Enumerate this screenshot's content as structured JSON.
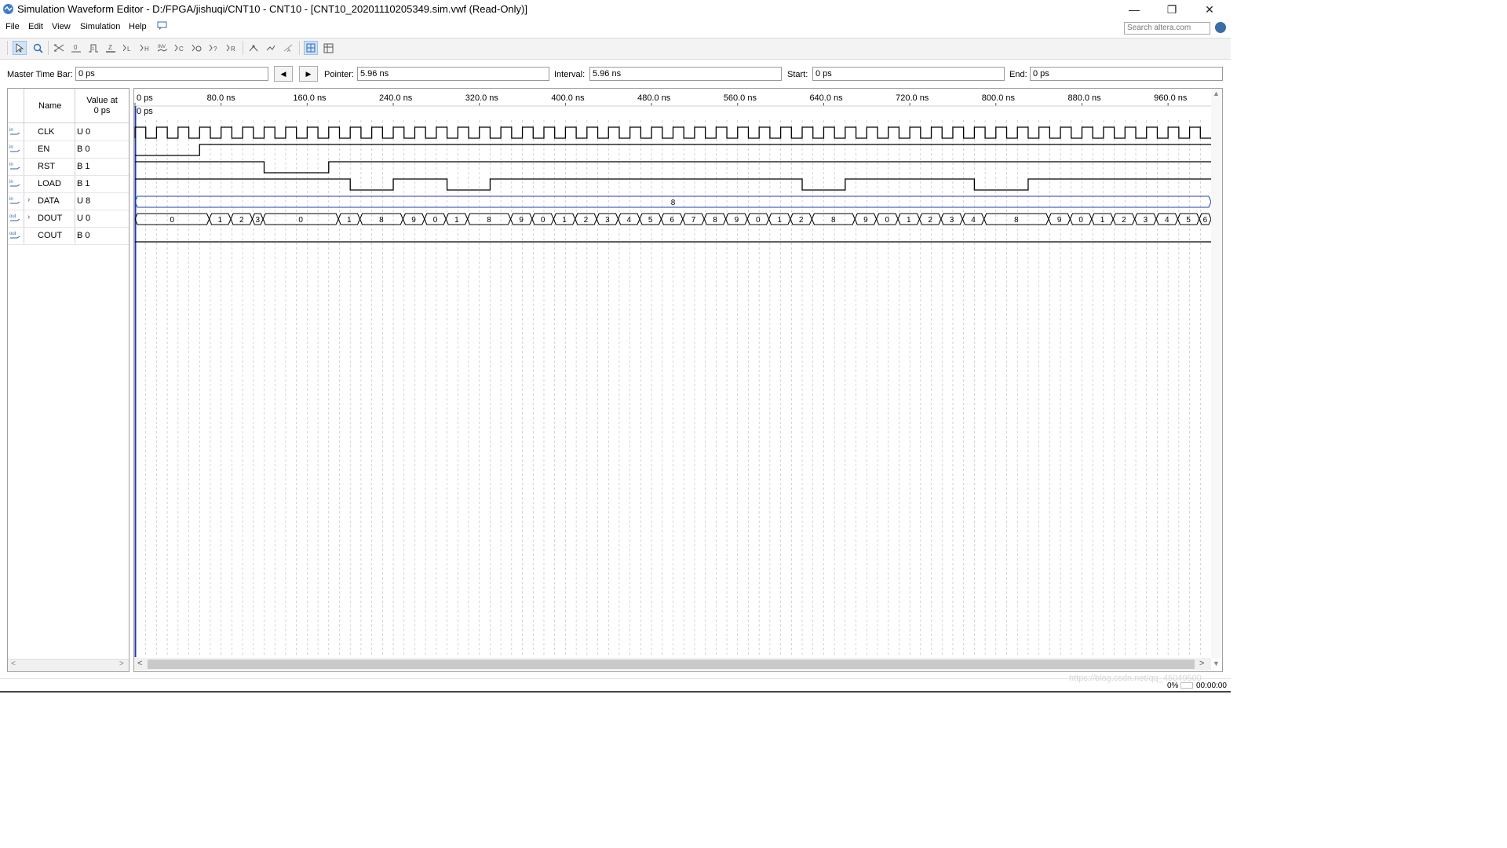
{
  "window": {
    "title": "Simulation Waveform Editor - D:/FPGA/jishuqi/CNT10 - CNT10 - [CNT10_20201110205349.sim.vwf (Read-Only)]",
    "min_glyph": "—",
    "max_glyph": "❐",
    "close_glyph": "✕"
  },
  "menu": {
    "items": [
      "File",
      "Edit",
      "View",
      "Simulation",
      "Help"
    ],
    "search_placeholder": "Search altera.com"
  },
  "toolbar": {
    "icons": [
      "select-tool",
      "zoom-tool",
      "forcing-unknown",
      "forcing-low",
      "forcing-high",
      "high-impedance",
      "weak-low",
      "weak-high",
      "invert",
      "count-value",
      "clock",
      "random-value",
      "overwrite-value",
      "snap-to-grid",
      "arbitrary-value",
      "grid-toggle",
      "display-settings"
    ]
  },
  "timebar": {
    "master_label": "Master Time Bar:",
    "master_value": "0 ps",
    "prev_glyph": "◀",
    "next_glyph": "▶",
    "pointer_label": "Pointer:",
    "pointer_value": "5.96 ns",
    "interval_label": "Interval:",
    "interval_value": "5.96 ns",
    "start_label": "Start:",
    "start_value": "0 ps",
    "end_label": "End:",
    "end_value": "0 ps"
  },
  "signals": {
    "header_name": "Name",
    "header_value_line1": "Value at",
    "header_value_line2": "0 ps",
    "rows": [
      {
        "dir": "in",
        "expand": "",
        "name": "CLK",
        "value": "U 0"
      },
      {
        "dir": "in",
        "expand": "",
        "name": "EN",
        "value": "B 0"
      },
      {
        "dir": "in",
        "expand": "",
        "name": "RST",
        "value": "B 1"
      },
      {
        "dir": "in",
        "expand": "",
        "name": "LOAD",
        "value": "B 1"
      },
      {
        "dir": "in",
        "expand": "›",
        "name": "DATA",
        "value": "U 8"
      },
      {
        "dir": "out",
        "expand": "›",
        "name": "DOUT",
        "value": "U 0"
      },
      {
        "dir": "out",
        "expand": "",
        "name": "COUT",
        "value": "B 0"
      }
    ]
  },
  "timeline": {
    "unit": "ns",
    "ticks": [
      {
        "t": 0,
        "label": "0 ps"
      },
      {
        "t": 80,
        "label": "80.0 ns"
      },
      {
        "t": 160,
        "label": "160.0 ns"
      },
      {
        "t": 240,
        "label": "240.0 ns"
      },
      {
        "t": 320,
        "label": "320.0 ns"
      },
      {
        "t": 400,
        "label": "400.0 ns"
      },
      {
        "t": 480,
        "label": "480.0 ns"
      },
      {
        "t": 560,
        "label": "560.0 ns"
      },
      {
        "t": 640,
        "label": "640.0 ns"
      },
      {
        "t": 720,
        "label": "720.0 ns"
      },
      {
        "t": 800,
        "label": "800.0 ns"
      },
      {
        "t": 880,
        "label": "880.0 ns"
      },
      {
        "t": 960,
        "label": "960.0 ns"
      }
    ],
    "master_marker_label": "0 ps",
    "view_end": 1000,
    "clock_period": 20
  },
  "waveforms": {
    "EN": [
      [
        0,
        0
      ],
      [
        60,
        1
      ]
    ],
    "RST": [
      [
        0,
        1
      ],
      [
        120,
        0
      ],
      [
        180,
        1
      ]
    ],
    "LOAD": [
      [
        0,
        1
      ],
      [
        200,
        0
      ],
      [
        240,
        1
      ],
      [
        290,
        0
      ],
      [
        330,
        1
      ],
      [
        620,
        0
      ],
      [
        660,
        1
      ],
      [
        780,
        0
      ],
      [
        830,
        1
      ]
    ],
    "COUT": [
      [
        0,
        0
      ]
    ],
    "DATA_bus": [
      {
        "start": 0,
        "end": 1000,
        "label": "8"
      }
    ],
    "DOUT_bus": [
      {
        "start": 0,
        "end": 69,
        "label": "0"
      },
      {
        "start": 69,
        "end": 89,
        "label": "1"
      },
      {
        "start": 89,
        "end": 109,
        "label": "2"
      },
      {
        "start": 109,
        "end": 119,
        "label": "3"
      },
      {
        "start": 119,
        "end": 189,
        "label": "0"
      },
      {
        "start": 189,
        "end": 209,
        "label": "1"
      },
      {
        "start": 209,
        "end": 249,
        "label": "8"
      },
      {
        "start": 249,
        "end": 269,
        "label": "9"
      },
      {
        "start": 269,
        "end": 289,
        "label": "0"
      },
      {
        "start": 289,
        "end": 309,
        "label": "1"
      },
      {
        "start": 309,
        "end": 349,
        "label": "8"
      },
      {
        "start": 349,
        "end": 369,
        "label": "9"
      },
      {
        "start": 369,
        "end": 389,
        "label": "0"
      },
      {
        "start": 389,
        "end": 409,
        "label": "1"
      },
      {
        "start": 409,
        "end": 429,
        "label": "2"
      },
      {
        "start": 429,
        "end": 449,
        "label": "3"
      },
      {
        "start": 449,
        "end": 469,
        "label": "4"
      },
      {
        "start": 469,
        "end": 489,
        "label": "5"
      },
      {
        "start": 489,
        "end": 509,
        "label": "6"
      },
      {
        "start": 509,
        "end": 529,
        "label": "7"
      },
      {
        "start": 529,
        "end": 549,
        "label": "8"
      },
      {
        "start": 549,
        "end": 569,
        "label": "9"
      },
      {
        "start": 569,
        "end": 589,
        "label": "0"
      },
      {
        "start": 589,
        "end": 609,
        "label": "1"
      },
      {
        "start": 609,
        "end": 629,
        "label": "2"
      },
      {
        "start": 629,
        "end": 669,
        "label": "8"
      },
      {
        "start": 669,
        "end": 689,
        "label": "9"
      },
      {
        "start": 689,
        "end": 709,
        "label": "0"
      },
      {
        "start": 709,
        "end": 729,
        "label": "1"
      },
      {
        "start": 729,
        "end": 749,
        "label": "2"
      },
      {
        "start": 749,
        "end": 769,
        "label": "3"
      },
      {
        "start": 769,
        "end": 789,
        "label": "4"
      },
      {
        "start": 789,
        "end": 849,
        "label": "8"
      },
      {
        "start": 849,
        "end": 869,
        "label": "9"
      },
      {
        "start": 869,
        "end": 889,
        "label": "0"
      },
      {
        "start": 889,
        "end": 909,
        "label": "1"
      },
      {
        "start": 909,
        "end": 929,
        "label": "2"
      },
      {
        "start": 929,
        "end": 949,
        "label": "3"
      },
      {
        "start": 949,
        "end": 969,
        "label": "4"
      },
      {
        "start": 969,
        "end": 989,
        "label": "5"
      },
      {
        "start": 989,
        "end": 1000,
        "label": "6"
      }
    ]
  },
  "status": {
    "percent": "0%",
    "elapsed": "00:00:00",
    "watermark": "https://blog.csdn.net/qq_45049500"
  },
  "colors": {
    "wave": "#000000",
    "bus": "#1f3fa8",
    "grid": "#b8b8b8",
    "marker": "#1e3ca8"
  }
}
